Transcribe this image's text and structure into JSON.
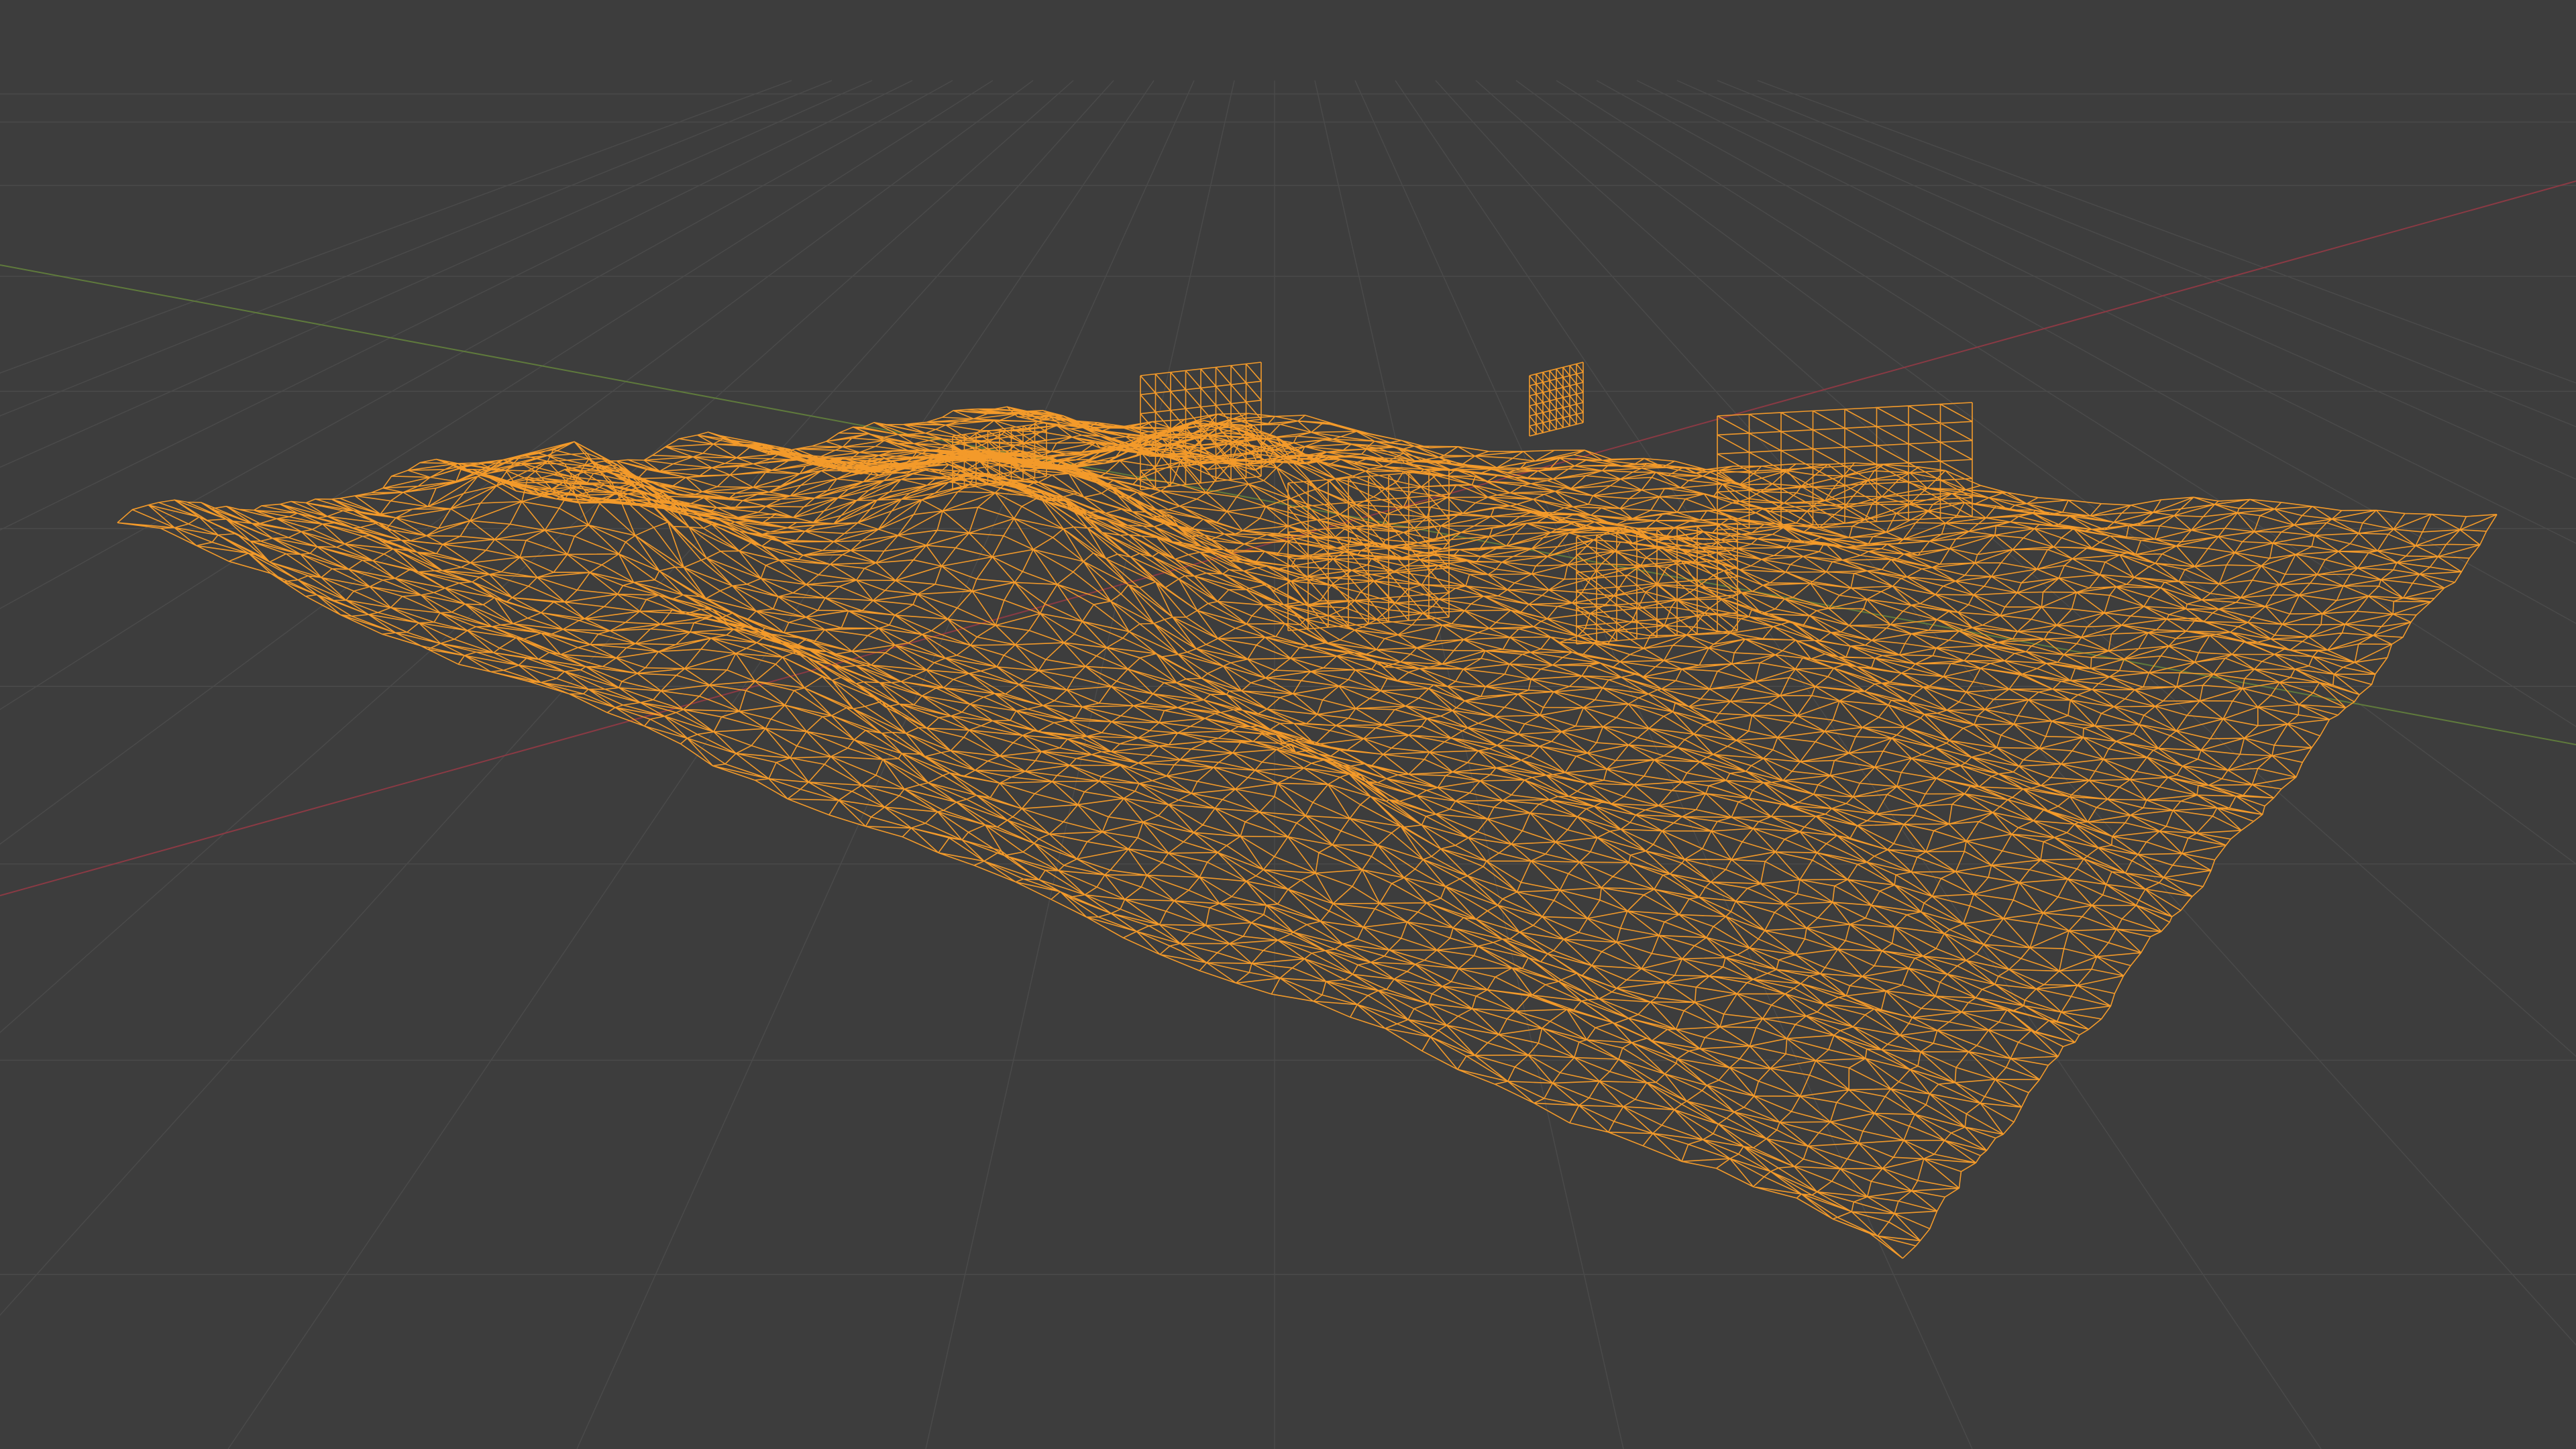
{
  "viewport": {
    "background_color": "#3d3d3d",
    "grid_color": "#4a4a4a",
    "x_axis_color": "#8a3a44",
    "y_axis_color": "#5f7a3c",
    "wireframe_color": "#f39a2a",
    "mesh_shading": "wireframe",
    "object_selected": true
  }
}
